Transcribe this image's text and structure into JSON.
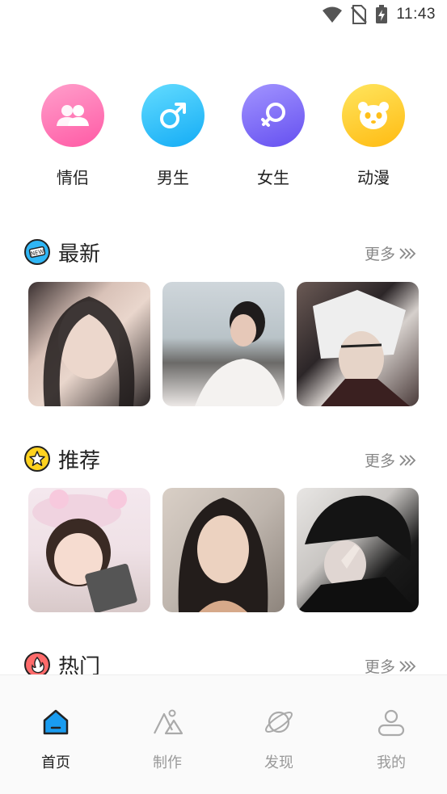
{
  "status_bar": {
    "time": "11:43",
    "icons": [
      "wifi-icon",
      "no-sim-icon",
      "battery-charging-icon"
    ]
  },
  "categories": [
    {
      "label": "情侣",
      "icon": "couple-icon",
      "color_from": "#ff8ec4",
      "color_to": "#ff5fa8"
    },
    {
      "label": "男生",
      "icon": "male-icon",
      "color_from": "#5fd9ff",
      "color_to": "#1fb2f7"
    },
    {
      "label": "女生",
      "icon": "female-icon",
      "color_from": "#9a8cff",
      "color_to": "#6b58f2"
    },
    {
      "label": "动漫",
      "icon": "panda-icon",
      "color_from": "#ffe25a",
      "color_to": "#ffbf1a"
    }
  ],
  "sections": {
    "latest": {
      "title": "最新",
      "more": "更多",
      "icon": "new-badge-icon"
    },
    "recommend": {
      "title": "推荐",
      "more": "更多",
      "icon": "star-icon"
    },
    "hot": {
      "title": "热门",
      "more": "更多",
      "icon": "fire-icon"
    }
  },
  "tab_bar": {
    "active_color": "#1a9cf0",
    "tabs": [
      {
        "label": "首页",
        "icon": "home-icon",
        "active": true
      },
      {
        "label": "制作",
        "icon": "mountain-create-icon",
        "active": false
      },
      {
        "label": "发现",
        "icon": "planet-icon",
        "active": false
      },
      {
        "label": "我的",
        "icon": "user-icon",
        "active": false
      }
    ]
  }
}
